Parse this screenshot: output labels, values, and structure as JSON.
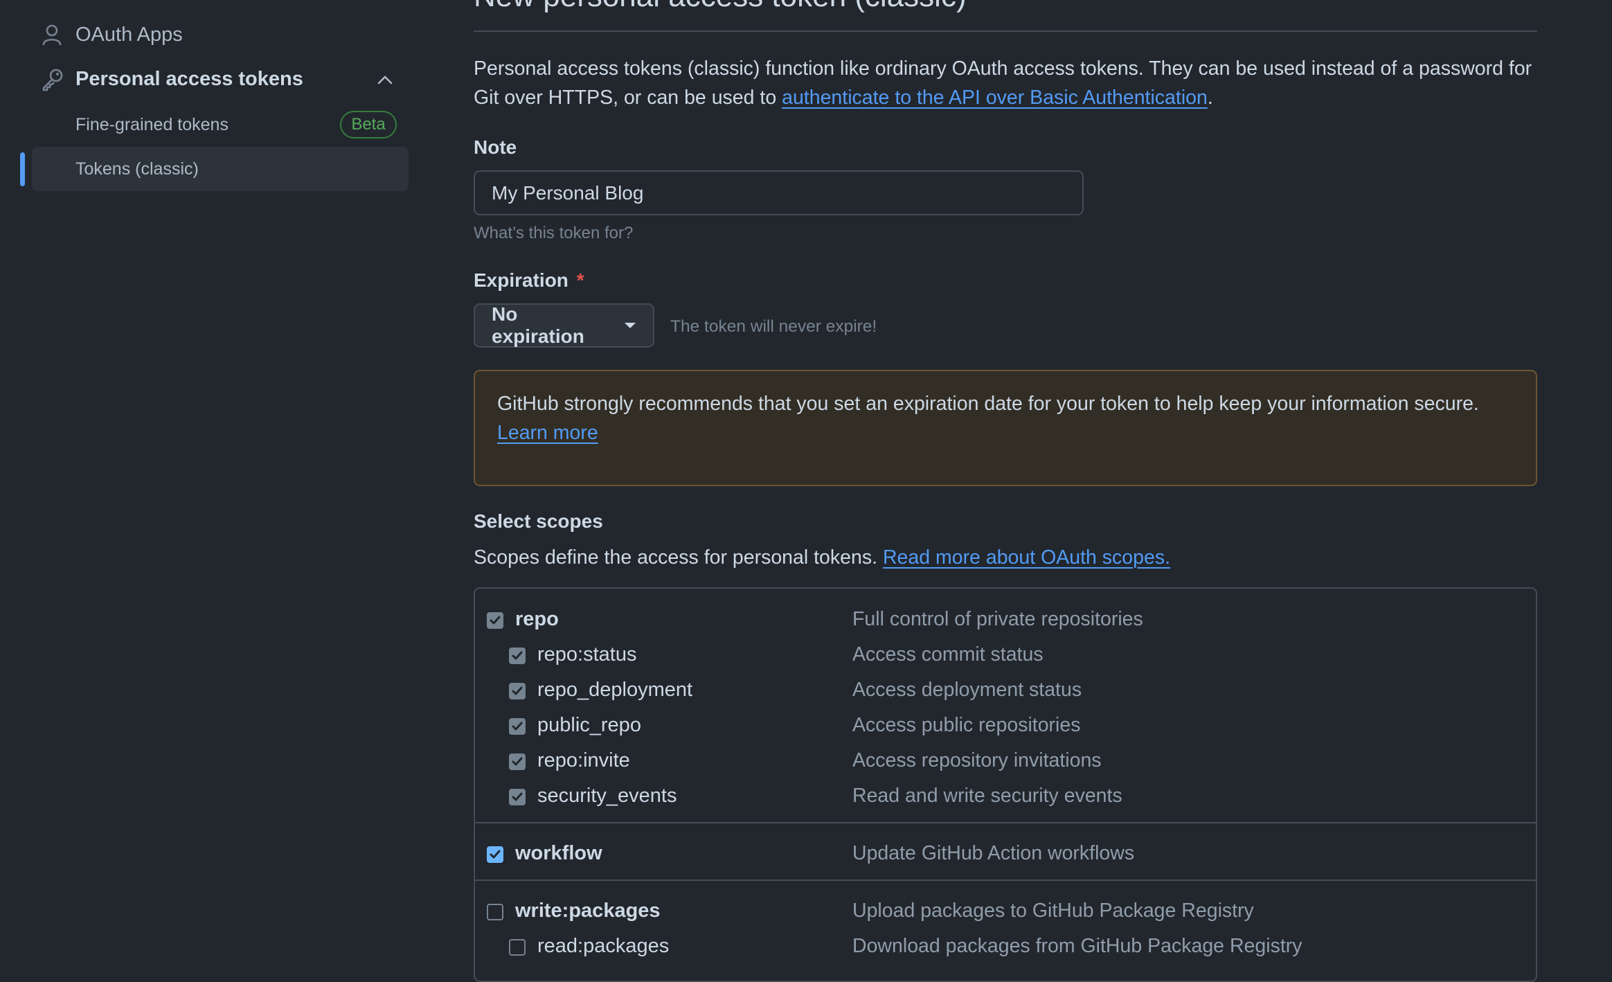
{
  "sidebar": {
    "oauth_apps": "OAuth Apps",
    "personal_access_tokens": "Personal access tokens",
    "fine_grained_tokens": "Fine-grained tokens",
    "beta_badge": "Beta",
    "tokens_classic": "Tokens (classic)"
  },
  "main": {
    "title": "New personal access token (classic)",
    "intro_text": "Personal access tokens (classic) function like ordinary OAuth access tokens. They can be used instead of a password for Git over HTTPS, or can be used to ",
    "intro_link": "authenticate to the API over Basic Authentication",
    "intro_end": ".",
    "note_label": "Note",
    "note_value": "My Personal Blog",
    "note_hint": "What’s this token for?",
    "expiration_label": "Expiration",
    "required_mark": "*",
    "expiration_value": "No expiration",
    "expiration_hint": "The token will never expire!",
    "warning_text": "GitHub strongly recommends that you set an expiration date for your token to help keep your information secure.",
    "warning_link": "Learn more",
    "scopes_title": "Select scopes",
    "scopes_text": "Scopes define the access for personal tokens.",
    "scopes_link": "Read more about OAuth scopes."
  },
  "scopes": [
    {
      "name": "repo",
      "desc": "Full control of private repositories",
      "checked": true
    },
    {
      "name": "repo:status",
      "desc": "Access commit status",
      "checked": true
    },
    {
      "name": "repo_deployment",
      "desc": "Access deployment status",
      "checked": true
    },
    {
      "name": "public_repo",
      "desc": "Access public repositories",
      "checked": true
    },
    {
      "name": "repo:invite",
      "desc": "Access repository invitations",
      "checked": true
    },
    {
      "name": "security_events",
      "desc": "Read and write security events",
      "checked": true
    },
    {
      "name": "workflow",
      "desc": "Update GitHub Action workflows",
      "checked": true
    },
    {
      "name": "write:packages",
      "desc": "Upload packages to GitHub Package Registry",
      "checked": false
    },
    {
      "name": "read:packages",
      "desc": "Download packages from GitHub Package Registry",
      "checked": false
    }
  ],
  "icons": {
    "oauth": "person-icon",
    "tokens": "key-icon",
    "collapse": "chevron-up-icon",
    "dropdown": "caret-down-icon"
  },
  "colors": {
    "accent": "#539bf5",
    "required": "#e5534b",
    "warning_border": "#6e5433",
    "beta": "#57ab5a"
  }
}
